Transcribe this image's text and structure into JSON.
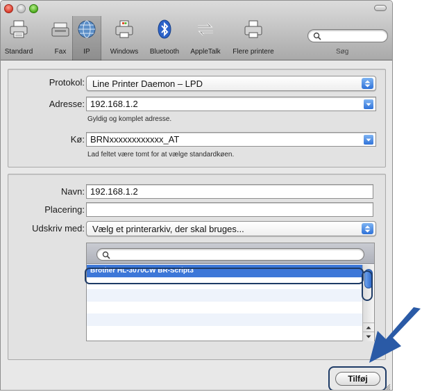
{
  "toolbar": {
    "items": [
      {
        "label": "Standard",
        "icon": "printer-icon"
      },
      {
        "label": "Fax",
        "icon": "fax-icon"
      },
      {
        "label": "IP",
        "icon": "globe-icon",
        "selected": true
      },
      {
        "label": "Windows",
        "icon": "windows-printer-icon"
      },
      {
        "label": "Bluetooth",
        "icon": "bluetooth-icon"
      },
      {
        "label": "AppleTalk",
        "icon": "appletalk-icon"
      },
      {
        "label": "Flere printere",
        "icon": "more-printers-icon"
      }
    ],
    "search_label": "Søg",
    "search_value": ""
  },
  "connection": {
    "protocol_label": "Protokol:",
    "protocol_value": "Line Printer Daemon – LPD",
    "address_label": "Adresse:",
    "address_value": "192.168.1.2",
    "address_hint": "Gyldig og komplet adresse.",
    "queue_label": "Kø:",
    "queue_value": "BRNxxxxxxxxxxxx_AT",
    "queue_hint": "Lad feltet være tomt for at vælge standardkøen."
  },
  "printer": {
    "name_label": "Navn:",
    "name_value": "192.168.1.2",
    "location_label": "Placering:",
    "location_value": "",
    "print_using_label": "Udskriv med:",
    "print_using_value": "Vælg et printerarkiv, der skal bruges...",
    "driver_search_value": "",
    "drivers": [
      "Brother HL-3070CW BR-Script3"
    ]
  },
  "actions": {
    "add_label": "Tilføj"
  },
  "colors": {
    "selection": "#3d77d8",
    "annotation": "#1e3b66",
    "arrow": "#2a5aa6"
  }
}
